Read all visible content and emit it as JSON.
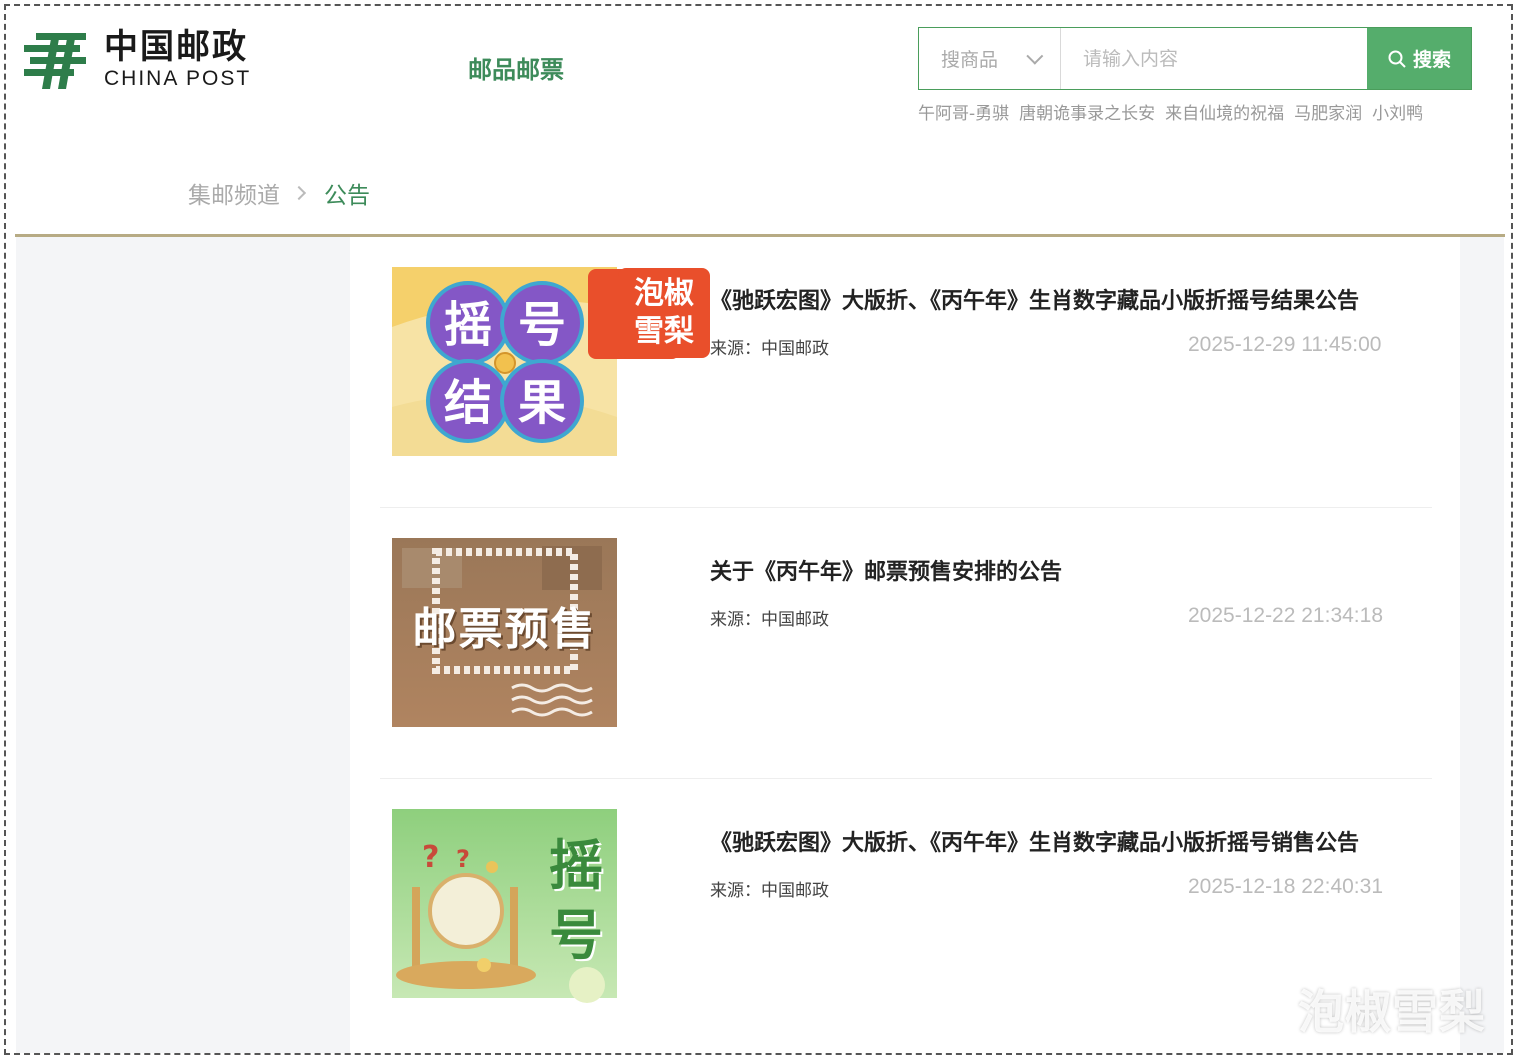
{
  "brand": {
    "name_cn": "中国邮政",
    "name_en": "CHINA POST",
    "green": "#3d8b5a"
  },
  "nav": {
    "title": "邮品邮票"
  },
  "search": {
    "category": "搜商品",
    "placeholder": "请输入内容",
    "button_label": "搜索",
    "button_color": "#55ad6c"
  },
  "hot_keywords": [
    "午阿哥-勇骐",
    "唐朝诡事录之长安",
    "来自仙境的祝福",
    "马肥家润",
    "小刘鸭"
  ],
  "breadcrumb": {
    "home": "集邮频道",
    "current": "公告"
  },
  "articles": [
    {
      "title": "《驰跃宏图》大版折、《丙午年》生肖数字藏品小版折摇号结果公告",
      "source": "来源：中国邮政",
      "date": "2025-12-29 11:45:00",
      "thumb_text": [
        "摇",
        "号",
        "结",
        "果"
      ],
      "thumb_stamp": "泡椒雪梨",
      "thumb_icon": "lottery-result-thumbnail"
    },
    {
      "title": "关于《丙午年》邮票预售安排的公告",
      "source": "来源：中国邮政",
      "date": "2025-12-22 21:34:18",
      "thumb_text": "邮票预售",
      "thumb_icon": "stamp-presale-thumbnail"
    },
    {
      "title": "《驰跃宏图》大版折、《丙午年》生肖数字藏品小版折摇号销售公告",
      "source": "来源：中国邮政",
      "date": "2025-12-18 22:40:31",
      "thumb_text": [
        "摇",
        "号"
      ],
      "thumb_icon": "lottery-drum-thumbnail"
    }
  ],
  "watermark": "泡椒雪梨"
}
